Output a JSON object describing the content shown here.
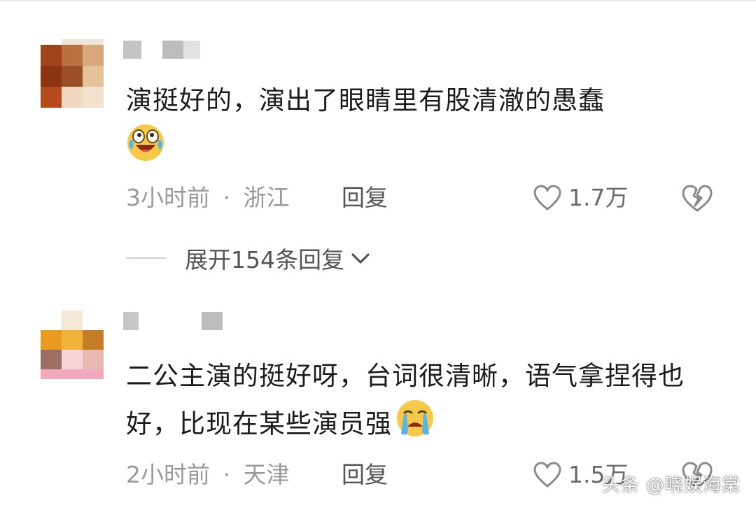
{
  "comments": [
    {
      "text": "演挺好的，演出了眼睛里有股清澈的愚蠢",
      "emoji": "laughing-crying-emoji",
      "time": "3小时前",
      "separator": "·",
      "location": "浙江",
      "reply_label": "回复",
      "like_count": "1.7万",
      "expand_label": "展开154条回复"
    },
    {
      "text": "二公主演的挺好呀，台词很清晰，语气拿捏得也好，比现在某些演员强",
      "emoji": "crying-emoji",
      "time": "2小时前",
      "separator": "·",
      "location": "天津",
      "reply_label": "回复",
      "like_count": "1.5万"
    }
  ],
  "watermark": "头条 @晓娱海棠",
  "colors": {
    "meta_gray": "#9a9a9a",
    "text": "#1c1c1c",
    "emoji_yellow": "#f7c948",
    "tear_blue": "#5bb4e8"
  }
}
